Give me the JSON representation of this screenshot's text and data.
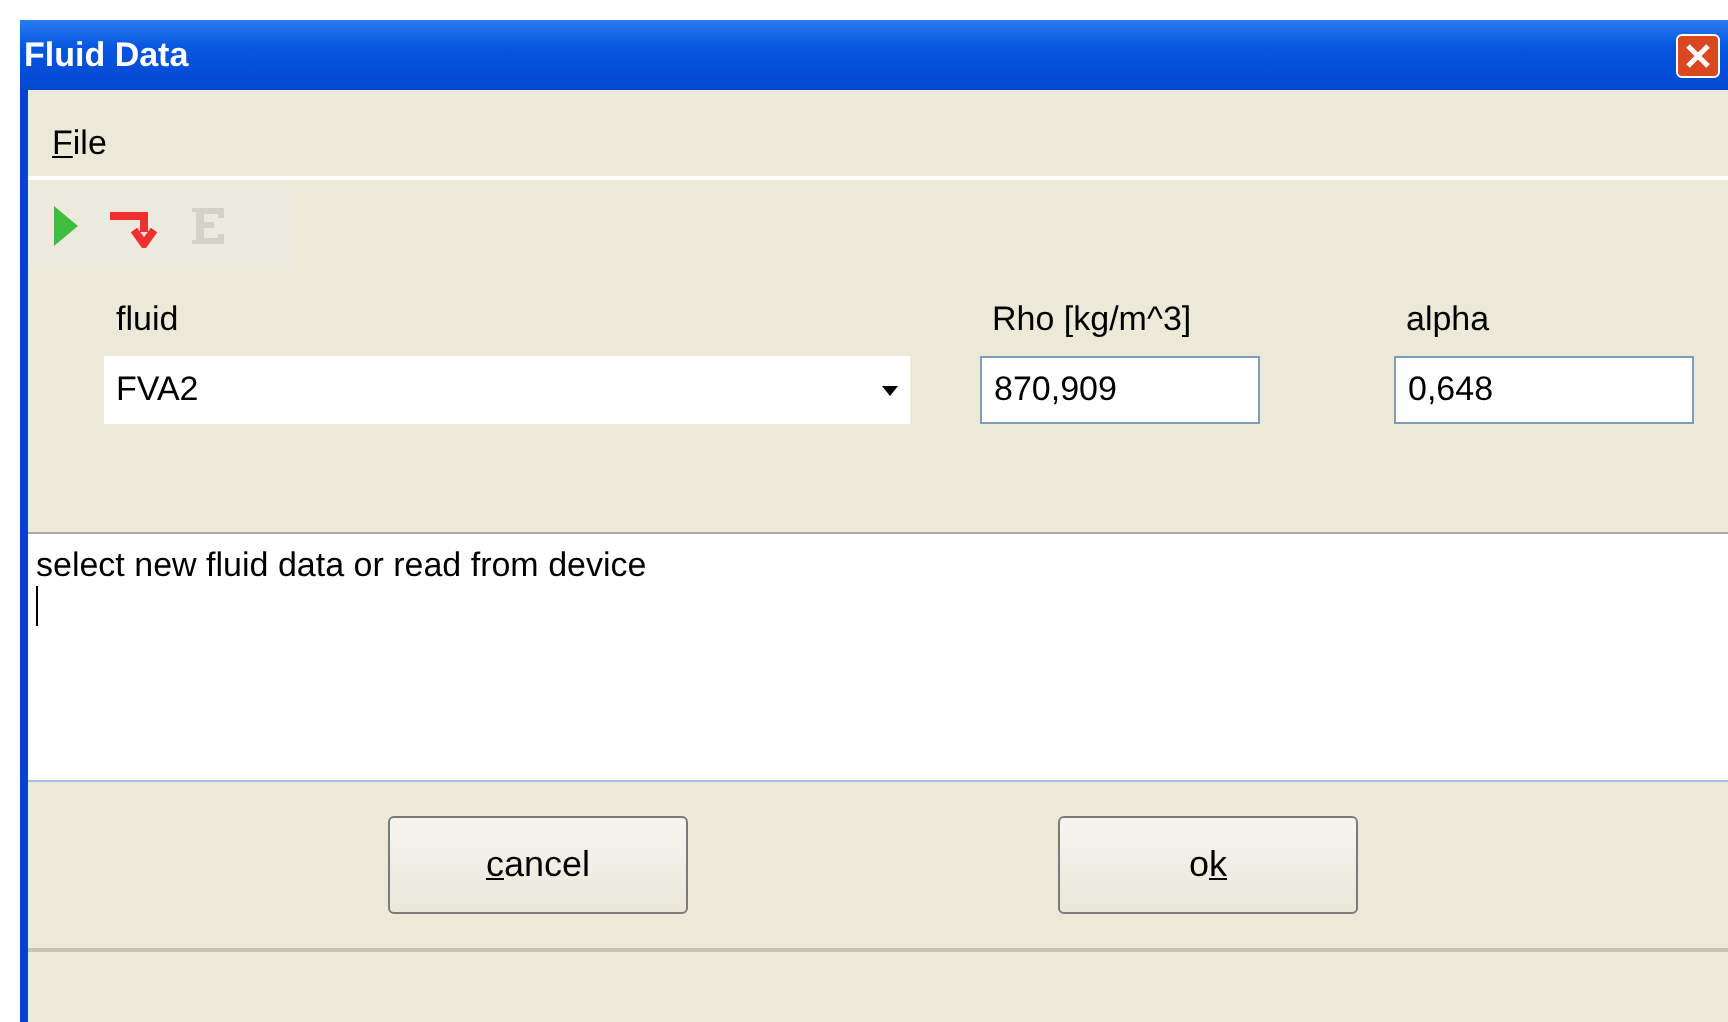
{
  "window": {
    "title": "Fluid Data"
  },
  "menu": [
    {
      "label": [
        {
          "text": "F",
          "underlined": true
        },
        {
          "text": "ile",
          "underlined": false
        }
      ]
    }
  ],
  "toolbar": [
    {
      "kind": "play",
      "disabled": false
    },
    {
      "kind": "jump",
      "disabled": false
    },
    {
      "kind": "letter",
      "disabled": true
    }
  ],
  "fluid": {
    "label": "fluid",
    "value": "FVA2"
  },
  "rho": {
    "label": "Rho [kg/m^3]",
    "value": "870,909"
  },
  "alpha": {
    "label": "alpha",
    "value": "0,648"
  },
  "message": "select new fluid data or read from device",
  "buttons": [
    {
      "label": [
        {
          "text": "c",
          "underlined": true
        },
        {
          "text": "ancel",
          "underlined": false
        }
      ]
    },
    {
      "label": [
        {
          "text": "o",
          "underlined": false
        },
        {
          "text": "k",
          "underlined": true
        }
      ]
    }
  ]
}
